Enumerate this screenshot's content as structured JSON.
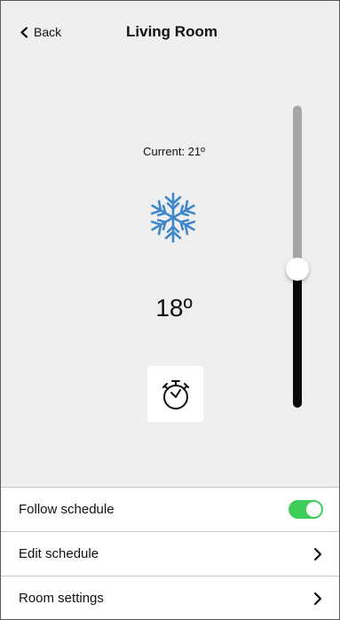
{
  "header": {
    "back_label": "Back",
    "title": "Living Room"
  },
  "thermostat": {
    "current_label": "Current: 21º",
    "mode_icon": "snowflake-icon",
    "setpoint": "18º",
    "setpoint_level_fraction": 0.46,
    "timer_icon": "stopwatch-icon",
    "mode_color": "#3f87c9"
  },
  "list": {
    "items": [
      {
        "label": "Follow schedule",
        "control": "toggle",
        "on": true
      },
      {
        "label": "Edit schedule",
        "control": "chevron"
      },
      {
        "label": "Room settings",
        "control": "chevron"
      }
    ]
  },
  "colors": {
    "toggle_on": "#3dcd58",
    "background": "#efefef"
  }
}
